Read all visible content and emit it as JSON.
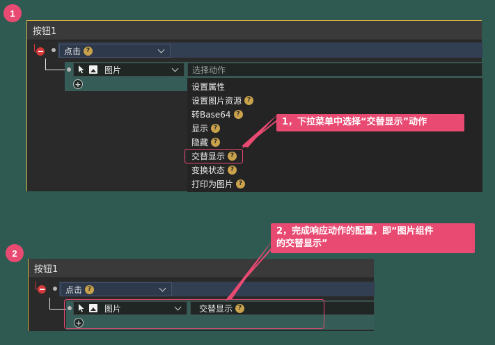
{
  "steps": {
    "one": "1",
    "two": "2"
  },
  "panel1": {
    "title": "按钮1",
    "event_label": "点击",
    "target_label": "图片",
    "action_placeholder": "选择动作"
  },
  "dropdown": {
    "items": [
      {
        "label": "设置属性",
        "help": false
      },
      {
        "label": "设置图片资源",
        "help": true
      },
      {
        "label": "转Base64",
        "help": true
      },
      {
        "label": "显示",
        "help": true
      },
      {
        "label": "隐藏",
        "help": true
      },
      {
        "label": "交替显示",
        "help": true
      },
      {
        "label": "变换状态",
        "help": true
      },
      {
        "label": "打印为图片",
        "help": true
      }
    ]
  },
  "panel2": {
    "title": "按钮1",
    "event_label": "点击",
    "target_label": "图片",
    "action_value": "交替显示"
  },
  "callouts": {
    "one": "1，下拉菜单中选择“交替显示”动作",
    "two_line1": "2，完成响应动作的配置，即“图片组件",
    "two_line2": "的交替显示”"
  },
  "help_glyph": "?",
  "colors": {
    "background": "#2f5a52",
    "accent": "#e84a72",
    "panel_border": "#d7b244",
    "event_row": "#323e52",
    "target_row": "#365c58",
    "help_badge": "#c9a24b"
  },
  "icons": [
    "cursor-icon",
    "image-icon",
    "minus-circle-icon",
    "plus-circle-icon",
    "chevron-down-icon",
    "help-icon"
  ]
}
